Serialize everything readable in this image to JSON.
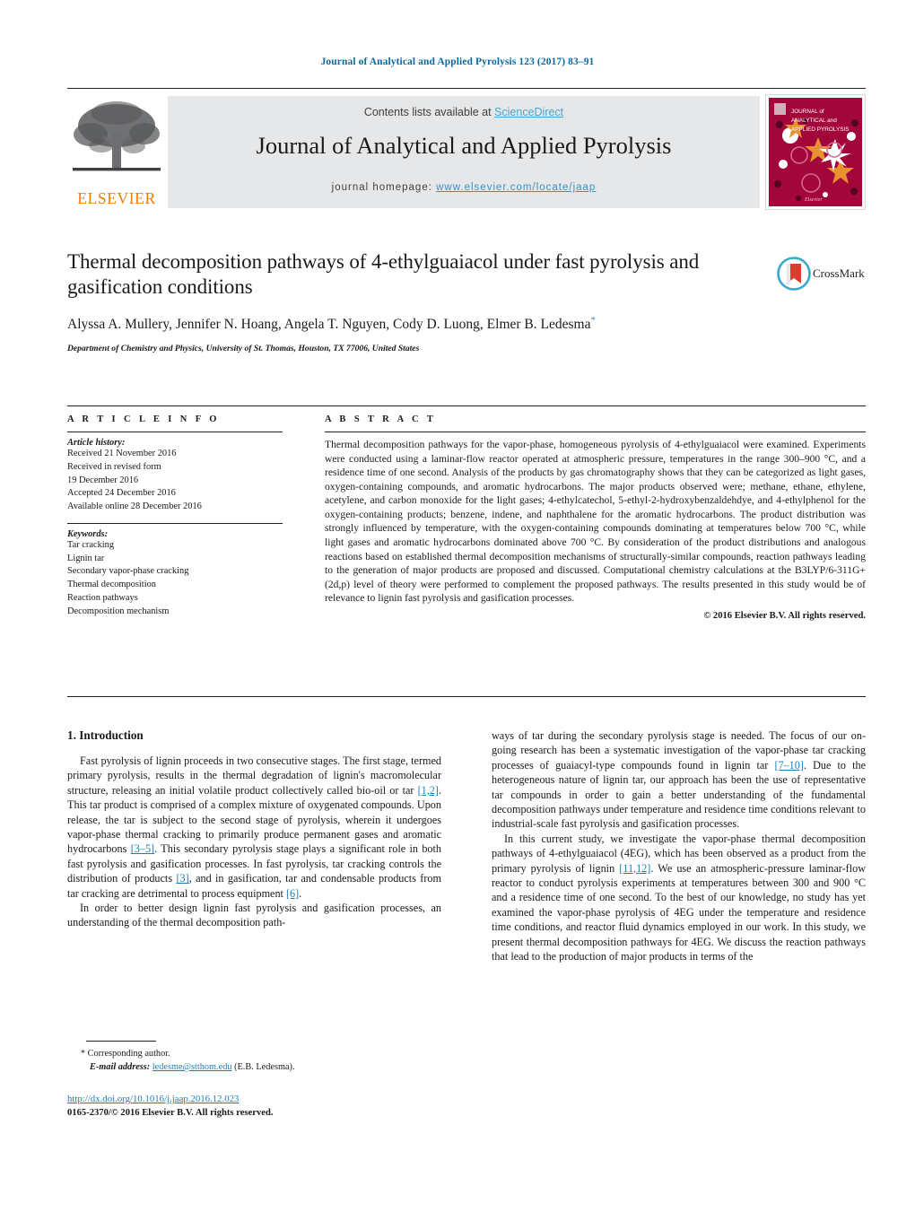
{
  "running_head": "Journal of Analytical and Applied Pyrolysis 123 (2017) 83–91",
  "masthead": {
    "contents_prefix": "Contents lists available at ",
    "sciencedirect": "ScienceDirect",
    "journal_title": "Journal of Analytical and Applied Pyrolysis",
    "homepage_label": "journal homepage: ",
    "homepage_url": "www.elsevier.com/locate/jaap",
    "publisher_wordmark": "ELSEVIER",
    "cover_line1": "JOURNAL of",
    "cover_line2": "ANALYTICAL and",
    "cover_line3": "APPLIED PYROLYSIS",
    "cover_brand": "Elsevier"
  },
  "colors": {
    "link_blue": "#1b7fb5",
    "sciencedirect_blue": "#4aa5d4",
    "elsevier_orange": "#f07d00",
    "cover_crimson": "#a3063a",
    "band_grey": "#e6e7e8"
  },
  "article": {
    "title": "Thermal decomposition pathways of 4-ethylguaiacol under fast pyrolysis and gasification conditions",
    "authors": "Alyssa A. Mullery, Jennifer N. Hoang, Angela T. Nguyen, Cody D. Luong, Elmer B. Ledesma",
    "corresponding_marker": "*",
    "affiliation": "Department of Chemistry and Physics, University of St. Thomas, Houston, TX 77006, United States",
    "crossmark_label": "CrossMark"
  },
  "article_info": {
    "heading": "A R T I C L E    I N F O",
    "history_label": "Article history:",
    "history": [
      "Received 21 November 2016",
      "Received in revised form",
      "19 December 2016",
      "Accepted 24 December 2016",
      "Available online 28 December 2016"
    ],
    "keywords_label": "Keywords:",
    "keywords": [
      "Tar cracking",
      "Lignin tar",
      "Secondary vapor-phase cracking",
      "Thermal decomposition",
      "Reaction pathways",
      "Decomposition mechanism"
    ]
  },
  "abstract": {
    "heading": "A B S T R A C T",
    "text": "Thermal decomposition pathways for the vapor-phase, homogeneous pyrolysis of 4-ethylguaiacol were examined. Experiments were conducted using a laminar-flow reactor operated at atmospheric pressure, temperatures in the range 300–900 °C, and a residence time of one second. Analysis of the products by gas chromatography shows that they can be categorized as light gases, oxygen-containing compounds, and aromatic hydrocarbons. The major products observed were; methane, ethane, ethylene, acetylene, and carbon monoxide for the light gases; 4-ethylcatechol, 5-ethyl-2-hydroxybenzaldehdye, and 4-ethylphenol for the oxygen-containing products; benzene, indene, and naphthalene for the aromatic hydrocarbons. The product distribution was strongly influenced by temperature, with the oxygen-containing compounds dominating at temperatures below 700 °C, while light gases and aromatic hydrocarbons dominated above 700 °C. By consideration of the product distributions and analogous reactions based on established thermal decomposition mechanisms of structurally-similar compounds, reaction pathways leading to the generation of major products are proposed and discussed. Computational chemistry calculations at the B3LYP/6-311G+(2d,p) level of theory were performed to complement the proposed pathways. The results presented in this study would be of relevance to lignin fast pyrolysis and gasification processes.",
    "copyright": "© 2016 Elsevier B.V. All rights reserved."
  },
  "body": {
    "section_heading": "1.  Introduction",
    "left_paragraph_1_a": "Fast pyrolysis of lignin proceeds in two consecutive stages. The first stage, termed primary pyrolysis, results in the thermal degradation of lignin's macromolecular structure, releasing an initial volatile product collectively called bio-oil or tar ",
    "left_ref_1": "[1,2]",
    "left_paragraph_1_b": ". This tar product is comprised of a complex mixture of oxygenated compounds. Upon release, the tar is subject to the second stage of pyrolysis, wherein it undergoes vapor-phase thermal cracking to primarily produce permanent gases and aromatic hydrocarbons ",
    "left_ref_2": "[3–5]",
    "left_paragraph_1_c": ". This secondary pyrolysis stage plays a significant role in both fast pyrolysis and gasification processes. In fast pyrolysis, tar cracking controls the distribution of products ",
    "left_ref_3": "[3]",
    "left_paragraph_1_d": ", and in gasification, tar and condensable products from tar cracking are detrimental to process equipment ",
    "left_ref_4": "[6]",
    "left_paragraph_1_e": ".",
    "left_paragraph_2": "In order to better design lignin fast pyrolysis and gasification processes, an understanding of the thermal decomposition path-",
    "right_paragraph_1_a": "ways of tar during the secondary pyrolysis stage is needed. The focus of our on-going research has been a systematic investigation of the vapor-phase tar cracking processes of guaiacyl-type compounds found in lignin tar ",
    "right_ref_1": "[7–10]",
    "right_paragraph_1_b": ". Due to the heterogeneous nature of lignin tar, our approach has been the use of representative tar compounds in order to gain a better understanding of the fundamental decomposition pathways under temperature and residence time conditions relevant to industrial-scale fast pyrolysis and gasification processes.",
    "right_paragraph_2_a": "In this current study, we investigate the vapor-phase thermal decomposition pathways of 4-ethylguaiacol (4EG), which has been observed as a product from the primary pyrolysis of lignin ",
    "right_ref_2": "[11,12]",
    "right_paragraph_2_b": ". We use an atmospheric-pressure laminar-flow reactor to conduct pyrolysis experiments at temperatures between 300 and 900 °C and a residence time of one second. To the best of our knowledge, no study has yet examined the vapor-phase pyrolysis of 4EG under the temperature and residence time conditions, and reactor fluid dynamics employed in our work. In this study, we present thermal decomposition pathways for 4EG. We discuss the reaction pathways that lead to the production of major products in terms of the"
  },
  "footer": {
    "corresponding_marker": "*",
    "corresponding_label": " Corresponding author.",
    "email_label": "E-mail address:",
    "email": "ledesme@stthom.edu",
    "email_owner": "(E.B. Ledesma).",
    "doi_url": "http://dx.doi.org/10.1016/j.jaap.2016.12.023",
    "issn_line": "0165-2370/© 2016 Elsevier B.V. All rights reserved."
  }
}
